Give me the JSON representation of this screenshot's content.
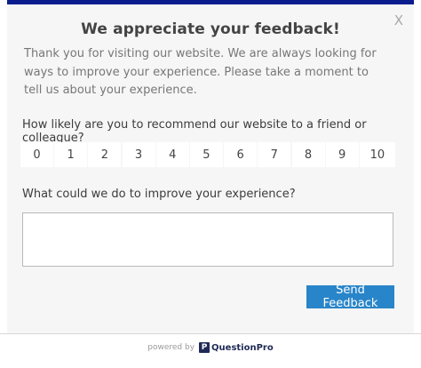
{
  "modal": {
    "close_label": "X",
    "title": "We appreciate your feedback!",
    "intro": "Thank you for visiting our website. We are always looking for ways to improve your experience. Please take a moment to tell us about your experience.",
    "question1": "How likely are you to recommend our website to a friend or colleague?",
    "scale": [
      "0",
      "1",
      "2",
      "3",
      "4",
      "5",
      "6",
      "7",
      "8",
      "9",
      "10"
    ],
    "question2": "What could we do to improve your experience?",
    "feedback_value": "",
    "send_label": "Send Feedback"
  },
  "footer": {
    "powered_by": "powered by",
    "logo_letter": "P",
    "brand": "QuestionPro"
  },
  "colors": {
    "top_bar": "#0b1d8e",
    "button": "#2985c9",
    "panel": "#f6f6f6"
  }
}
